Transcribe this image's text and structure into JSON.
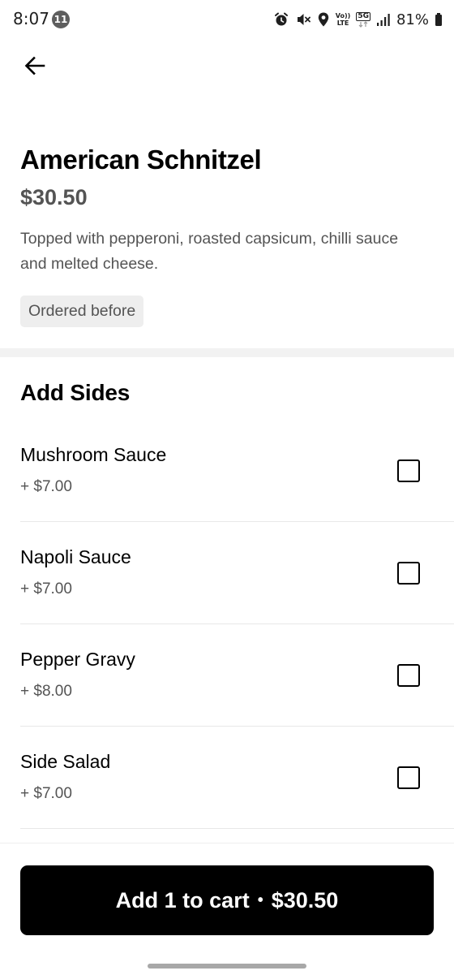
{
  "status_bar": {
    "time": "8:07",
    "notification_count": "11",
    "volte_top": "Vo))",
    "volte_bottom": "LTE",
    "network": "5G",
    "battery": "81%"
  },
  "item": {
    "title": "American Schnitzel",
    "price": "$30.50",
    "description": "Topped with pepperoni, roasted capsicum, chilli sauce and melted cheese.",
    "badge": "Ordered before"
  },
  "sides": {
    "title": "Add Sides",
    "options": [
      {
        "name": "Mushroom Sauce",
        "price": "+ $7.00",
        "checked": false
      },
      {
        "name": "Napoli Sauce",
        "price": "+ $7.00",
        "checked": false
      },
      {
        "name": "Pepper Gravy",
        "price": "+ $8.00",
        "checked": false
      },
      {
        "name": "Side Salad",
        "price": "+ $7.00",
        "checked": false
      }
    ]
  },
  "cart_button": {
    "label": "Add 1 to cart",
    "separator": "•",
    "total": "$30.50"
  },
  "icons": {
    "back": "arrow-left-icon",
    "alarm": "alarm-icon",
    "mute": "mute-icon",
    "location": "location-icon",
    "signal": "signal-icon",
    "battery": "battery-icon"
  },
  "colors": {
    "primary_text": "#000000",
    "secondary_text": "#545454",
    "badge_background": "#eeeeee",
    "button_background": "#000000",
    "button_text": "#ffffff"
  }
}
